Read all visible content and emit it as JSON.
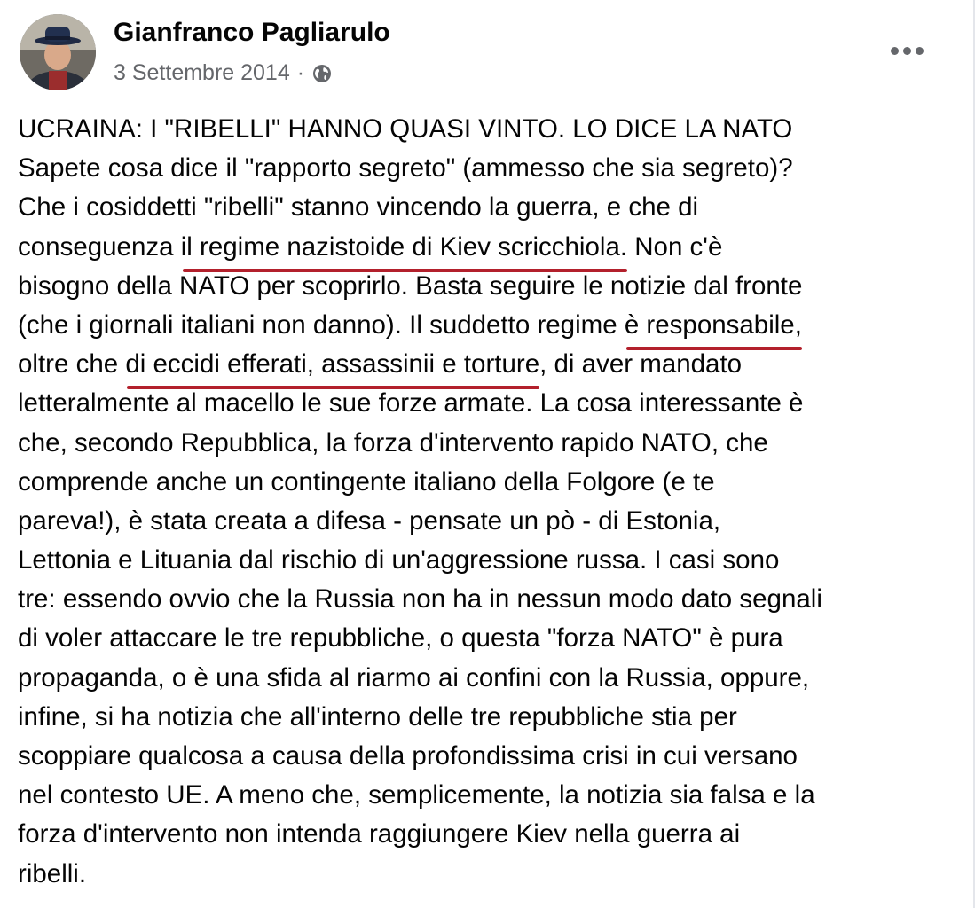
{
  "post": {
    "author": "Gianfranco Pagliarulo",
    "date": "3 Settembre 2014",
    "separator": "·",
    "privacy_icon": "globe-icon",
    "more_icon": "more-options-icon",
    "underline_color": "#b3202c",
    "lines": [
      {
        "parts": [
          {
            "text": "UCRAINA: I \"RIBELLI\" HANNO QUASI VINTO. LO DICE LA NATO"
          }
        ]
      },
      {
        "parts": [
          {
            "text": "Sapete cosa dice il \"rapporto segreto\" (ammesso che sia segreto)?"
          }
        ]
      },
      {
        "parts": [
          {
            "text": "Che i cosiddetti \"ribelli\" stanno vincendo la guerra, e che di"
          }
        ]
      },
      {
        "parts": [
          {
            "text": "conseguenza "
          },
          {
            "text": "il regime nazistoide di Kiev scricchiola.",
            "u": true
          },
          {
            "text": " Non c'è"
          }
        ]
      },
      {
        "parts": [
          {
            "text": "bisogno della NATO per scoprirlo. Basta seguire le notizie dal fronte"
          }
        ]
      },
      {
        "parts": [
          {
            "text": "(che i giornali italiani non danno). Il suddetto regime "
          },
          {
            "text": "è responsabile,",
            "u": true
          }
        ]
      },
      {
        "parts": [
          {
            "text": "oltre che "
          },
          {
            "text": "di eccidi efferati, assassinii e torture",
            "u": true
          },
          {
            "text": ", di aver mandato"
          }
        ]
      },
      {
        "parts": [
          {
            "text": "letteralmente al macello le sue forze armate. La cosa interessante è"
          }
        ]
      },
      {
        "parts": [
          {
            "text": "che, secondo Repubblica, la forza d'intervento rapido NATO, che"
          }
        ]
      },
      {
        "parts": [
          {
            "text": "comprende anche un contingente italiano della Folgore (e te"
          }
        ]
      },
      {
        "parts": [
          {
            "text": "pareva!), è stata creata a difesa - pensate un pò - di Estonia,"
          }
        ]
      },
      {
        "parts": [
          {
            "text": "Lettonia e Lituania dal rischio di un'aggressione russa. I casi sono"
          }
        ]
      },
      {
        "parts": [
          {
            "text": "tre: essendo ovvio che la Russia non ha in nessun modo dato segnali"
          }
        ]
      },
      {
        "parts": [
          {
            "text": "di voler attaccare le tre repubbliche, o questa \"forza NATO\" è pura"
          }
        ]
      },
      {
        "parts": [
          {
            "text": "propaganda, o è una sfida al riarmo ai confini con la Russia, oppure,"
          }
        ]
      },
      {
        "parts": [
          {
            "text": "infine, si ha notizia che all'interno delle tre repubbliche stia per"
          }
        ]
      },
      {
        "parts": [
          {
            "text": "scoppiare qualcosa a causa della profondissima crisi in cui versano"
          }
        ]
      },
      {
        "parts": [
          {
            "text": "nel contesto UE. A meno che, semplicemente, la notizia sia falsa e la"
          }
        ]
      },
      {
        "parts": [
          {
            "text": "forza d'intervento non intenda raggiungere Kiev nella guerra ai"
          }
        ]
      },
      {
        "parts": [
          {
            "text": "ribelli."
          }
        ]
      }
    ]
  }
}
